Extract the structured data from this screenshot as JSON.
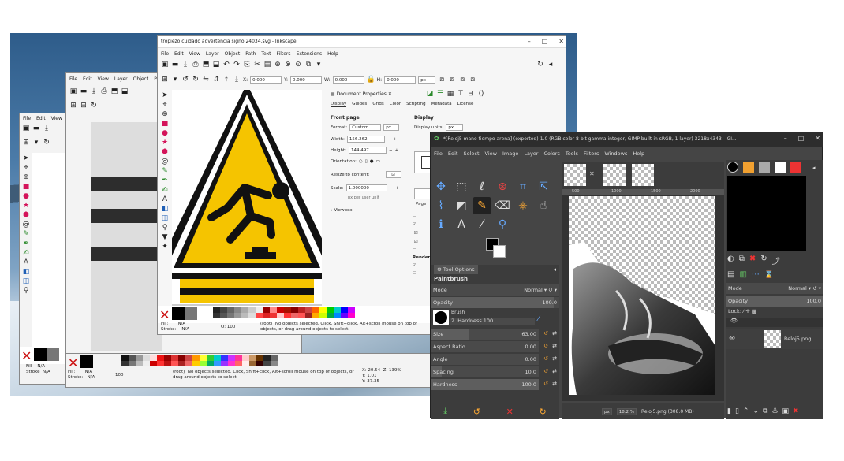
{
  "inkscape_front": {
    "title": "tropiezo cuidado advertencia signo 24034.svg - Inkscape",
    "menu": [
      "File",
      "Edit",
      "View",
      "Layer",
      "Object",
      "Path",
      "Text",
      "Filters",
      "Extensions",
      "Help"
    ],
    "coords": {
      "x_label": "X:",
      "x": "0.000",
      "y_label": "Y:",
      "y": "0.000",
      "w_label": "W:",
      "w": "0.000",
      "h_label": "H:",
      "h": "0.000",
      "unit": "px"
    },
    "doc_props": {
      "panel_title": "Document Properties",
      "tabs": [
        "Display",
        "Guides",
        "Grids",
        "Color",
        "Scripting",
        "Metadata",
        "License"
      ],
      "front_page": "Front page",
      "display": "Display",
      "format_label": "Format:",
      "format_value": "Custom",
      "format_unit": "px",
      "display_units_label": "Display units:",
      "display_units_value": "px",
      "width_label": "Width:",
      "width_value": "156.262",
      "height_label": "Height:",
      "height_value": "144.497",
      "orientation_label": "Orientation:",
      "resize_label": "Resize to content:",
      "scale_label": "Scale:",
      "scale_value": "1.000000",
      "scale_note": "px per user unit",
      "viewbox": "Viewbox",
      "page_label": "Page",
      "render_label": "Render"
    },
    "status": {
      "fill_label": "Fill:",
      "fill_value": "N/A",
      "stroke_label": "Stroke:",
      "stroke_value": "N/A",
      "opacity_label": "O:",
      "opacity_value": "100",
      "layer": "(root)",
      "message": "No objects selected. Click, Shift+click, Alt+scroll mouse on top of objects, or drag around objects to select."
    }
  },
  "inkscape_back": {
    "menu": [
      "File",
      "Edit",
      "View",
      "Layer",
      "Object",
      "Pa"
    ],
    "status": {
      "fill_label": "Fill:",
      "fill_value": "N/A",
      "stroke_label": "Stroke:",
      "stroke_value": "N/A",
      "opacity_value": "100",
      "layer": "(root)",
      "message": "No objects selected. Click, Shift+click, Alt+scroll mouse on top of objects, or drag around objects to select.",
      "x_label": "X:",
      "x_value": "20.54",
      "y_label": "Y:",
      "y_value": "1.01",
      "z_label": "Z:",
      "z_value": "139%",
      "y2_value": "37.35"
    }
  },
  "inkscape_small": {
    "menu": [
      "File",
      "Edit",
      "View"
    ],
    "status": {
      "fill_label": "Fill",
      "fill_value": "N/A",
      "stroke_label": "Stroke",
      "stroke_value": "N/A"
    }
  },
  "gimp": {
    "title": "*[Reloj5 mano tiempo arena] (exported)-1.0 (RGB color 8-bit gamma integer, GIMP built-in sRGB, 1 layer) 3218x4343 – GI...",
    "menu": [
      "File",
      "Edit",
      "Select",
      "View",
      "Image",
      "Layer",
      "Colors",
      "Tools",
      "Filters",
      "Windows",
      "Help"
    ],
    "tool_options_tab": "Tool Options",
    "tool_name": "Paintbrush",
    "mode_label": "Mode",
    "mode_value": "Normal",
    "opacity_label": "Opacity",
    "opacity_value": "100.0",
    "brush_label": "Brush",
    "brush_name": "2. Hardness 100",
    "sliders": [
      {
        "label": "Size",
        "value": "63.00"
      },
      {
        "label": "Aspect Ratio",
        "value": "0.00"
      },
      {
        "label": "Angle",
        "value": "0.00"
      },
      {
        "label": "Spacing",
        "value": "10.0"
      },
      {
        "label": "Hardness",
        "value": "100.0"
      }
    ],
    "ruler_marks": [
      "500",
      "1000",
      "1500",
      "2000"
    ],
    "zoom_unit": "px",
    "zoom_value": "18.2 %",
    "status_file": "Reloj5.png (308.0 MB)",
    "layers": {
      "mode_label": "Mode",
      "mode_value": "Normal",
      "opacity_label": "Opacity",
      "opacity_value": "100.0",
      "lock_label": "Lock:",
      "layer_name": "Reloj5.png"
    }
  },
  "colors": {
    "sign_yellow": "#f5c400",
    "sign_black": "#111111",
    "gimp_bg": "#454545"
  }
}
